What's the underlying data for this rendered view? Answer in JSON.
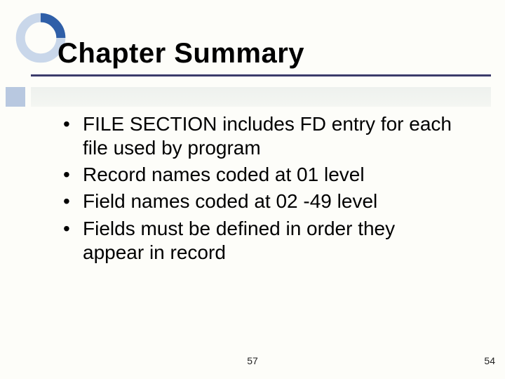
{
  "title": "Chapter Summary",
  "bullets": [
    "FILE SECTION includes FD entry for each file used by program",
    "Record names coded at 01 level",
    "Field names coded at 02 -49 level",
    "Fields must be defined in order they appear in record"
  ],
  "footer": {
    "center": "57",
    "right": "54"
  }
}
